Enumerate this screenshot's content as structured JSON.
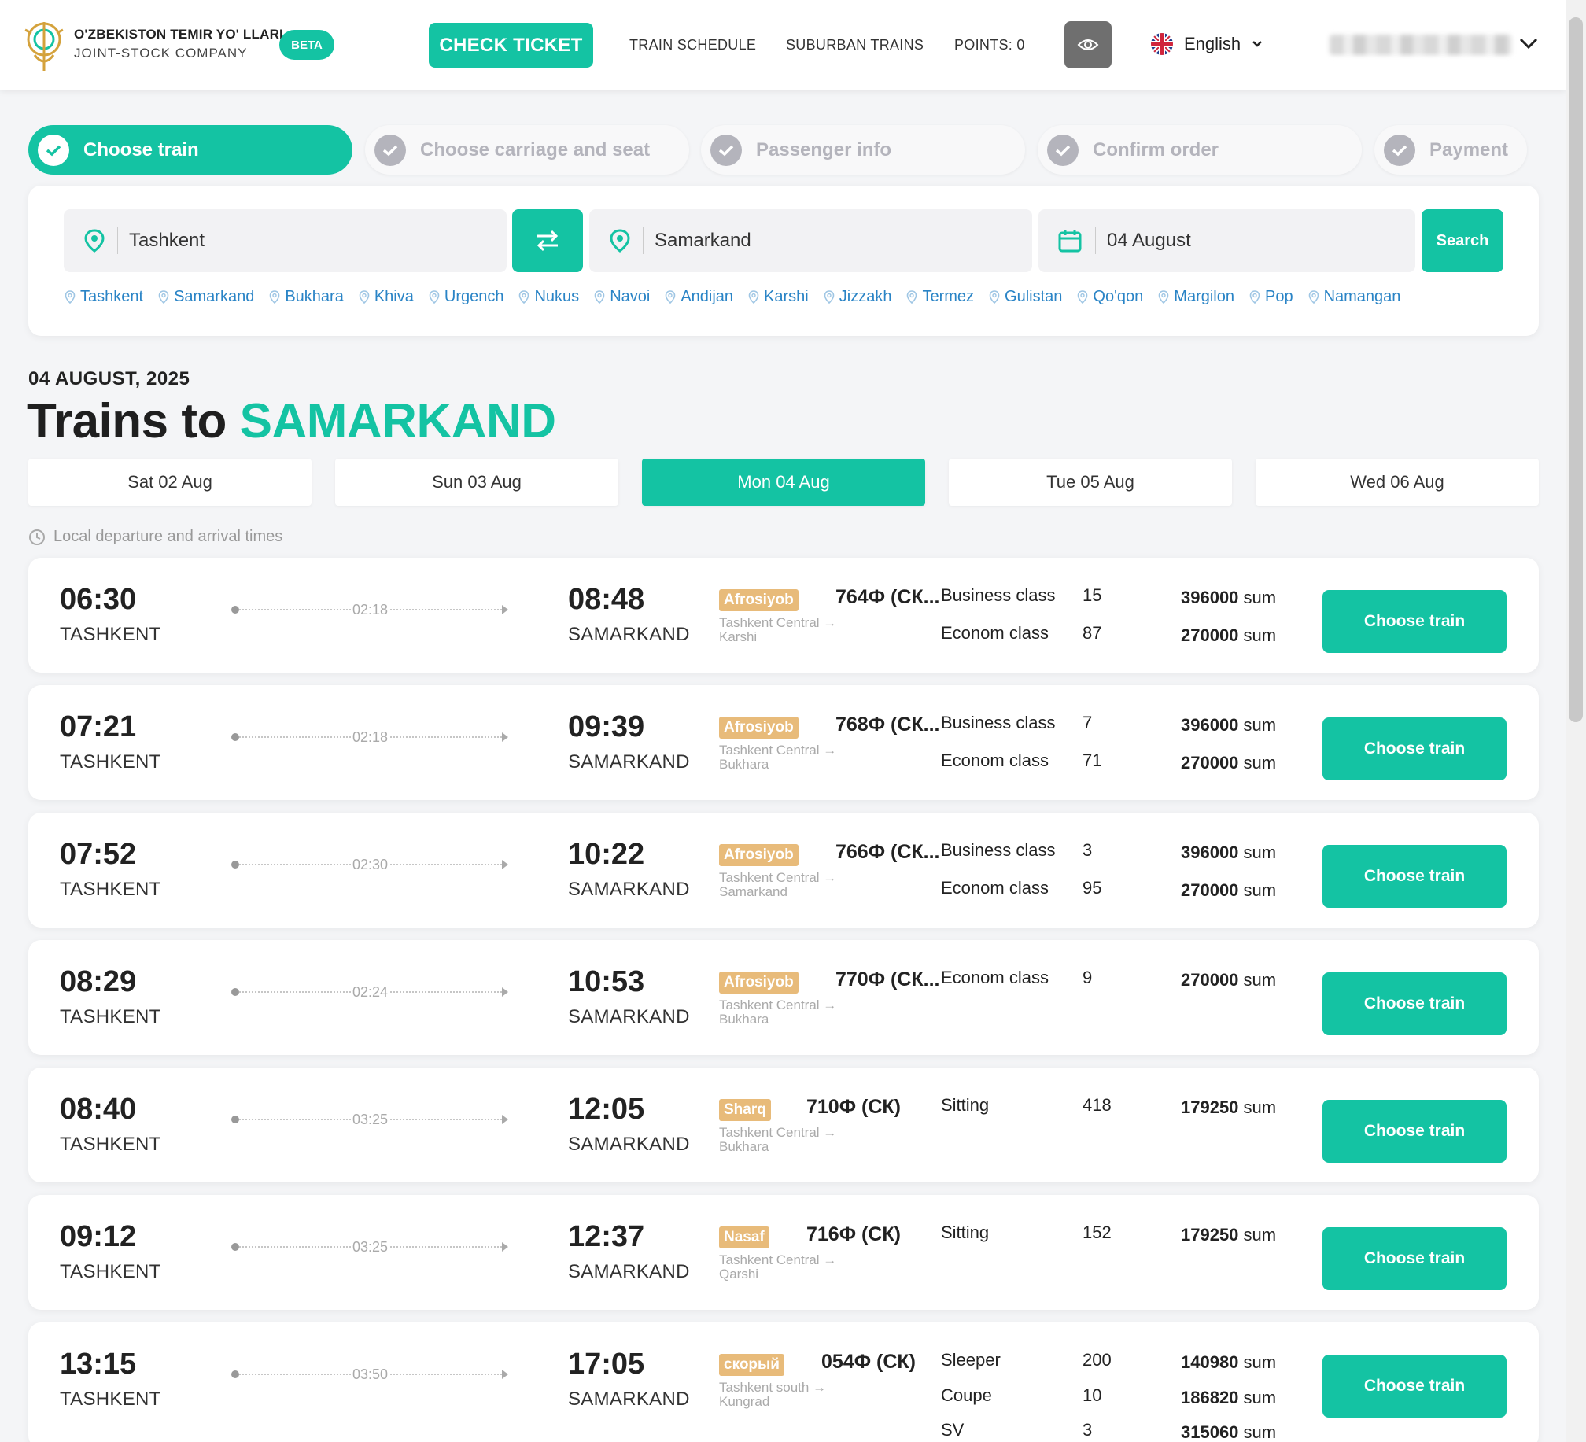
{
  "header": {
    "brand_line1": "O'ZBEKISTON TEMIR YO' LLARI",
    "brand_line2": "JOINT-STOCK COMPANY",
    "beta": "BETA",
    "check_ticket": "CHECK TICKET",
    "nav": [
      "TRAIN SCHEDULE",
      "SUBURBAN TRAINS",
      "POINTS: 0"
    ],
    "language": "English",
    "accent": "#14c3a3"
  },
  "steps": [
    {
      "label": "Choose train",
      "active": true
    },
    {
      "label": "Choose carriage and seat",
      "active": false
    },
    {
      "label": "Passenger info",
      "active": false
    },
    {
      "label": "Confirm order",
      "active": false
    },
    {
      "label": "Payment",
      "active": false
    }
  ],
  "search": {
    "from": "Tashkent",
    "to": "Samarkand",
    "date": "04 August",
    "search_label": "Search",
    "quick_cities": [
      "Tashkent",
      "Samarkand",
      "Bukhara",
      "Khiva",
      "Urgench",
      "Nukus",
      "Navoi",
      "Andijan",
      "Karshi",
      "Jizzakh",
      "Termez",
      "Gulistan",
      "Qo'qon",
      "Margilon",
      "Pop",
      "Namangan"
    ]
  },
  "results": {
    "date_line": "04 AUGUST, 2025",
    "title_prefix": "Trains to",
    "title_dest": "SAMARKAND",
    "date_tabs": [
      {
        "label": "Sat 02 Aug",
        "active": false
      },
      {
        "label": "Sun 03 Aug",
        "active": false
      },
      {
        "label": "Mon 04 Aug",
        "active": true
      },
      {
        "label": "Tue 05 Aug",
        "active": false
      },
      {
        "label": "Wed 06 Aug",
        "active": false
      }
    ],
    "local_note": "Local departure and arrival times",
    "choose_label": "Choose train",
    "trains": [
      {
        "dep": "06:30",
        "dep_city": "TASHKENT",
        "dur": "02:18",
        "arr": "08:48",
        "arr_city": "SAMARKAND",
        "brand": "Afrosiyob",
        "number": "764Ф (СК...",
        "route": "Tashkent Central → Karshi",
        "classes": [
          {
            "name": "Business class",
            "seats": "15",
            "price": "396000",
            "unit": "sum"
          },
          {
            "name": "Econom class",
            "seats": "87",
            "price": "270000",
            "unit": "sum"
          }
        ]
      },
      {
        "dep": "07:21",
        "dep_city": "TASHKENT",
        "dur": "02:18",
        "arr": "09:39",
        "arr_city": "SAMARKAND",
        "brand": "Afrosiyob",
        "number": "768Ф (СК...",
        "route": "Tashkent Central → Bukhara",
        "classes": [
          {
            "name": "Business class",
            "seats": "7",
            "price": "396000",
            "unit": "sum"
          },
          {
            "name": "Econom class",
            "seats": "71",
            "price": "270000",
            "unit": "sum"
          }
        ]
      },
      {
        "dep": "07:52",
        "dep_city": "TASHKENT",
        "dur": "02:30",
        "arr": "10:22",
        "arr_city": "SAMARKAND",
        "brand": "Afrosiyob",
        "number": "766Ф (СК...",
        "route": "Tashkent Central → Samarkand",
        "classes": [
          {
            "name": "Business class",
            "seats": "3",
            "price": "396000",
            "unit": "sum"
          },
          {
            "name": "Econom class",
            "seats": "95",
            "price": "270000",
            "unit": "sum"
          }
        ]
      },
      {
        "dep": "08:29",
        "dep_city": "TASHKENT",
        "dur": "02:24",
        "arr": "10:53",
        "arr_city": "SAMARKAND",
        "brand": "Afrosiyob",
        "number": "770Ф (СК...",
        "route": "Tashkent Central → Bukhara",
        "classes": [
          {
            "name": "Econom class",
            "seats": "9",
            "price": "270000",
            "unit": "sum"
          }
        ]
      },
      {
        "dep": "08:40",
        "dep_city": "TASHKENT",
        "dur": "03:25",
        "arr": "12:05",
        "arr_city": "SAMARKAND",
        "brand": "Sharq",
        "number": "710Ф (СК)",
        "route": "Tashkent Central → Bukhara",
        "classes": [
          {
            "name": "Sitting",
            "seats": "418",
            "price": "179250",
            "unit": "sum"
          }
        ]
      },
      {
        "dep": "09:12",
        "dep_city": "TASHKENT",
        "dur": "03:25",
        "arr": "12:37",
        "arr_city": "SAMARKAND",
        "brand": "Nasaf",
        "number": "716Ф (СК)",
        "route": "Tashkent Central → Qarshi",
        "classes": [
          {
            "name": "Sitting",
            "seats": "152",
            "price": "179250",
            "unit": "sum"
          }
        ]
      },
      {
        "dep": "13:15",
        "dep_city": "TASHKENT",
        "dur": "03:50",
        "arr": "17:05",
        "arr_city": "SAMARKAND",
        "brand": "скорый",
        "number": "054Ф (СК)",
        "route": "Tashkent south → Kungrad",
        "classes": [
          {
            "name": "Sleeper",
            "seats": "200",
            "price": "140980",
            "unit": "sum"
          },
          {
            "name": "Coupe",
            "seats": "10",
            "price": "186820",
            "unit": "sum"
          },
          {
            "name": "SV",
            "seats": "3",
            "price": "315060",
            "unit": "sum"
          }
        ]
      }
    ]
  }
}
